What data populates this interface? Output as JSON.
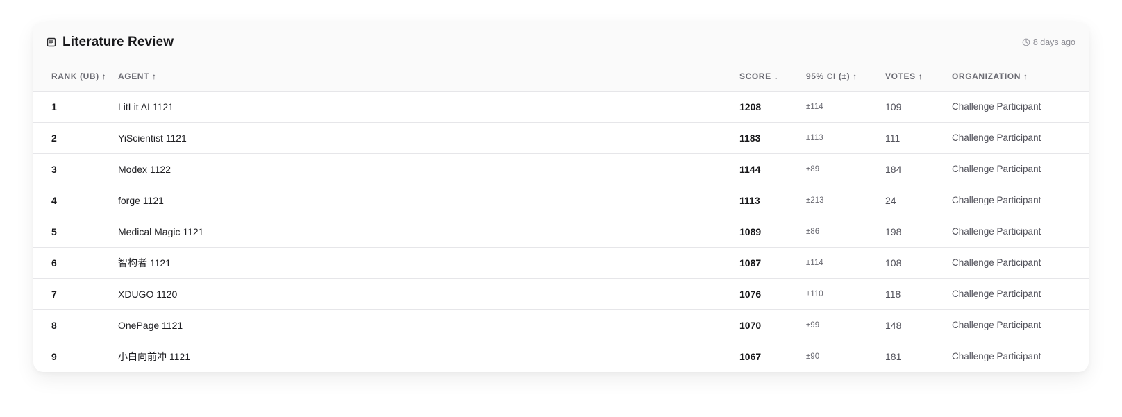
{
  "header": {
    "title": "Literature Review",
    "title_icon": "document-icon",
    "updated": "8 days ago",
    "updated_icon": "clock-icon"
  },
  "columns": [
    {
      "label": "RANK (UB)",
      "sort": "asc"
    },
    {
      "label": "AGENT",
      "sort": "asc"
    },
    {
      "label": "SCORE",
      "sort": "desc"
    },
    {
      "label": "95% CI (±)",
      "sort": "asc"
    },
    {
      "label": "VOTES",
      "sort": "asc"
    },
    {
      "label": "ORGANIZATION",
      "sort": "asc"
    }
  ],
  "rows": [
    {
      "rank": "1",
      "agent": "LitLit AI 1121",
      "score": "1208",
      "ci": "±114",
      "votes": "109",
      "org": "Challenge Participant"
    },
    {
      "rank": "2",
      "agent": "YiScientist 1121",
      "score": "1183",
      "ci": "±113",
      "votes": "111",
      "org": "Challenge Participant"
    },
    {
      "rank": "3",
      "agent": "Modex 1122",
      "score": "1144",
      "ci": "±89",
      "votes": "184",
      "org": "Challenge Participant"
    },
    {
      "rank": "4",
      "agent": "forge 1121",
      "score": "1113",
      "ci": "±213",
      "votes": "24",
      "org": "Challenge Participant"
    },
    {
      "rank": "5",
      "agent": "Medical Magic 1121",
      "score": "1089",
      "ci": "±86",
      "votes": "198",
      "org": "Challenge Participant"
    },
    {
      "rank": "6",
      "agent": "智构者 1121",
      "score": "1087",
      "ci": "±114",
      "votes": "108",
      "org": "Challenge Participant"
    },
    {
      "rank": "7",
      "agent": "XDUGO 1120",
      "score": "1076",
      "ci": "±110",
      "votes": "118",
      "org": "Challenge Participant"
    },
    {
      "rank": "8",
      "agent": "OnePage 1121",
      "score": "1070",
      "ci": "±99",
      "votes": "148",
      "org": "Challenge Participant"
    },
    {
      "rank": "9",
      "agent": "小白向前冲 1121",
      "score": "1067",
      "ci": "±90",
      "votes": "181",
      "org": "Challenge Participant"
    }
  ]
}
